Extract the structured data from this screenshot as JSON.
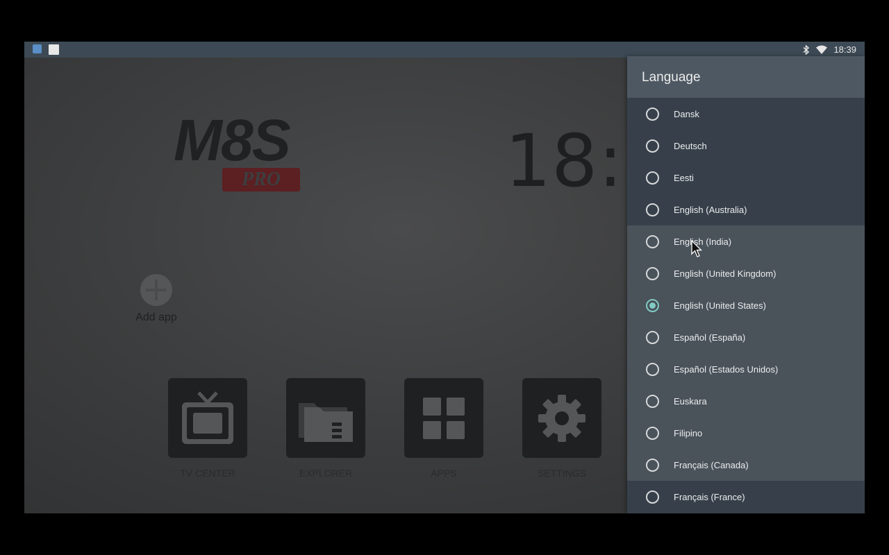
{
  "status_bar": {
    "time": "18:39",
    "icons": [
      "gallery-icon",
      "square-icon",
      "bluetooth-icon",
      "wifi-icon"
    ]
  },
  "home": {
    "logo_text": "M8S",
    "logo_badge": "PRO",
    "clock": "18:3",
    "add_app_label": "Add app",
    "tiles": [
      {
        "label": "TV CENTER",
        "icon": "tv-icon"
      },
      {
        "label": "EXPLORER",
        "icon": "folder-icon"
      },
      {
        "label": "APPS",
        "icon": "apps-grid-icon"
      },
      {
        "label": "SETTINGS",
        "icon": "gear-icon"
      }
    ]
  },
  "language_panel": {
    "title": "Language",
    "items": [
      {
        "label": "Dansk",
        "selected": false
      },
      {
        "label": "Deutsch",
        "selected": false
      },
      {
        "label": "Eesti",
        "selected": false
      },
      {
        "label": "English (Australia)",
        "selected": false
      },
      {
        "label": "English (India)",
        "selected": false
      },
      {
        "label": "English (United Kingdom)",
        "selected": false
      },
      {
        "label": "English (United States)",
        "selected": true
      },
      {
        "label": "Español (España)",
        "selected": false
      },
      {
        "label": "Español (Estados Unidos)",
        "selected": false
      },
      {
        "label": "Euskara",
        "selected": false
      },
      {
        "label": "Filipino",
        "selected": false
      },
      {
        "label": "Français (Canada)",
        "selected": false
      },
      {
        "label": "Français (France)",
        "selected": false
      }
    ]
  },
  "colors": {
    "accent": "#80cbc4",
    "panel_bg": "#37404a",
    "panel_header": "#4e5862"
  }
}
